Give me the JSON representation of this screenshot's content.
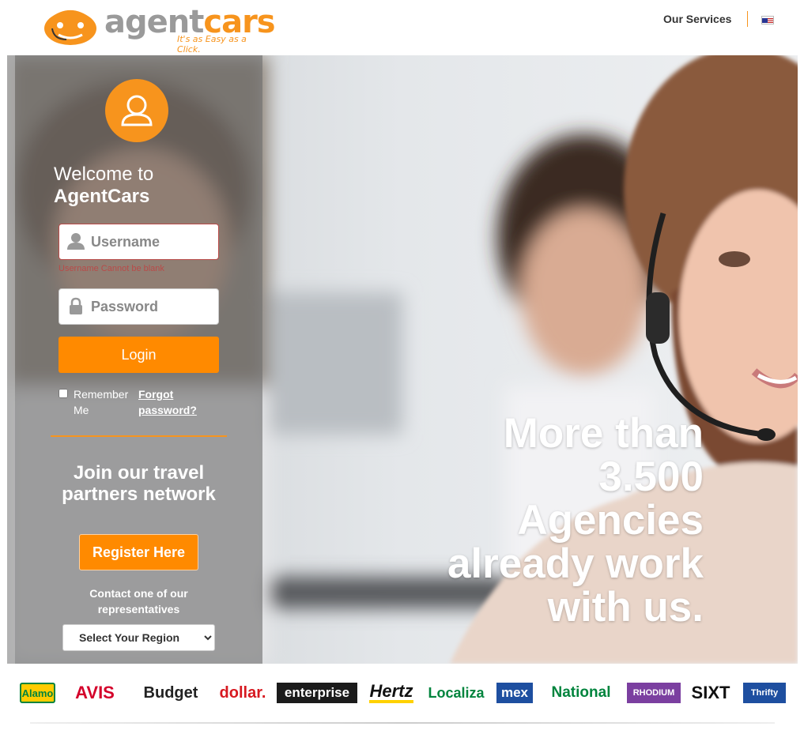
{
  "header": {
    "logo_agent": "agent",
    "logo_cars": "cars",
    "tagline": "It's as Easy as a Click.",
    "nav_services": "Our Services",
    "language_icon": "us-flag-icon"
  },
  "login": {
    "welcome_line1": "Welcome to",
    "welcome_brand": "AgentCars",
    "username_placeholder": "Username",
    "username_error": "Username Cannot be blank",
    "password_placeholder": "Password",
    "login_label": "Login",
    "remember_label": "Remember Me",
    "forgot_label": "Forgot password?"
  },
  "join": {
    "title": "Join our travel partners network",
    "register_label": "Register Here",
    "contact_text": "Contact one of our representatives",
    "region_selected": "Select Your Region"
  },
  "hero": {
    "headline": "More than 3.500 Agencies already work with us."
  },
  "partners": [
    {
      "name": "Alamo",
      "color": "#00843d",
      "bg": "#ffcc00"
    },
    {
      "name": "AVIS",
      "color": "#d4002a",
      "bg": "#ffffff"
    },
    {
      "name": "Budget",
      "color": "#222222",
      "bg": "#ffffff"
    },
    {
      "name": "dollar.",
      "color": "#d71920",
      "bg": "#ffffff"
    },
    {
      "name": "enterprise",
      "color": "#ffffff",
      "bg": "#1b1b1b"
    },
    {
      "name": "Hertz",
      "color": "#111111",
      "bg": "#ffd100"
    },
    {
      "name": "Localiza",
      "color": "#00843d",
      "bg": "#ffffff"
    },
    {
      "name": "mex",
      "color": "#ffffff",
      "bg": "#1e4fa0"
    },
    {
      "name": "National",
      "color": "#00843d",
      "bg": "#ffffff"
    },
    {
      "name": "RHODIUM",
      "color": "#ffffff",
      "bg": "#7b3fa0"
    },
    {
      "name": "SIXT",
      "color": "#111111",
      "bg": "#ffffff"
    },
    {
      "name": "Thrifty",
      "color": "#ffffff",
      "bg": "#1e4fa0"
    }
  ],
  "colors": {
    "accent": "#ff8a00",
    "logo_orange": "#f7941d",
    "logo_gray": "#9a9a9a",
    "error": "#b94a48"
  }
}
